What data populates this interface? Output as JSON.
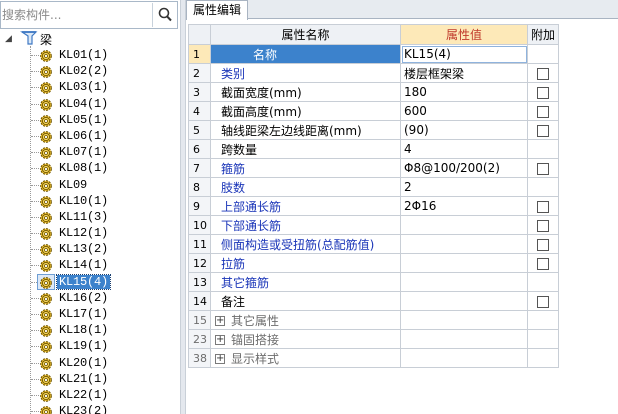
{
  "search": {
    "placeholder": "搜索构件..."
  },
  "tree": {
    "root_label": "梁",
    "items": [
      {
        "label": "KL01(1)"
      },
      {
        "label": "KL02(2)"
      },
      {
        "label": "KL03(1)"
      },
      {
        "label": "KL04(1)"
      },
      {
        "label": "KL05(1)"
      },
      {
        "label": "KL06(1)"
      },
      {
        "label": "KL07(1)"
      },
      {
        "label": "KL08(1)"
      },
      {
        "label": "KL09"
      },
      {
        "label": "KL10(1)"
      },
      {
        "label": "KL11(3)"
      },
      {
        "label": "KL12(1)"
      },
      {
        "label": "KL13(2)"
      },
      {
        "label": "KL14(1)"
      },
      {
        "label": "KL15(4)"
      },
      {
        "label": "KL16(2)"
      },
      {
        "label": "KL17(1)"
      },
      {
        "label": "KL18(1)"
      },
      {
        "label": "KL19(1)"
      },
      {
        "label": "KL20(1)"
      },
      {
        "label": "KL21(1)"
      },
      {
        "label": "KL22(1)"
      },
      {
        "label": "KL23(2)"
      }
    ],
    "selected": "KL15(4)"
  },
  "tabs": {
    "attr_label": "属性编辑"
  },
  "grid": {
    "headers": {
      "name": "属性名称",
      "value": "属性值",
      "extra": "附加"
    },
    "rows": [
      {
        "num": "1",
        "name": "名称",
        "value": "KL15(4)"
      },
      {
        "num": "2",
        "name": "类别",
        "value": "楼层框架梁"
      },
      {
        "num": "3",
        "name": "截面宽度(mm)",
        "value": "180"
      },
      {
        "num": "4",
        "name": "截面高度(mm)",
        "value": "600"
      },
      {
        "num": "5",
        "name": "轴线距梁左边线距离(mm)",
        "value": "(90)"
      },
      {
        "num": "6",
        "name": "跨数量",
        "value": "4"
      },
      {
        "num": "7",
        "name": "箍筋",
        "value": "Φ8@100/200(2)"
      },
      {
        "num": "8",
        "name": "肢数",
        "value": "2"
      },
      {
        "num": "9",
        "name": "上部通长筋",
        "value": "2Φ16"
      },
      {
        "num": "10",
        "name": "下部通长筋",
        "value": ""
      },
      {
        "num": "11",
        "name": "侧面构造或受扭筋(总配筋值)",
        "value": ""
      },
      {
        "num": "12",
        "name": "拉筋",
        "value": ""
      },
      {
        "num": "13",
        "name": "其它箍筋",
        "value": ""
      },
      {
        "num": "14",
        "name": "备注",
        "value": ""
      },
      {
        "num": "15",
        "name": "其它属性",
        "value": "",
        "expand": "+"
      },
      {
        "num": "23",
        "name": "锚固搭接",
        "value": "",
        "expand": "+"
      },
      {
        "num": "38",
        "name": "显示样式",
        "value": "",
        "expand": "+"
      }
    ]
  }
}
